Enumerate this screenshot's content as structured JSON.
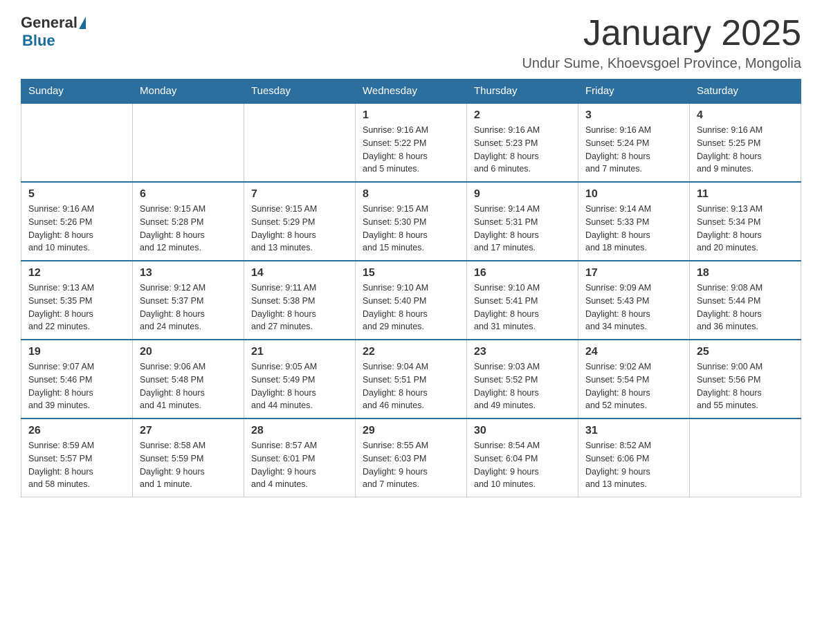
{
  "header": {
    "logo": {
      "general": "General",
      "blue": "Blue"
    },
    "title": "January 2025",
    "location": "Undur Sume, Khoevsgoel Province, Mongolia"
  },
  "calendar": {
    "days_of_week": [
      "Sunday",
      "Monday",
      "Tuesday",
      "Wednesday",
      "Thursday",
      "Friday",
      "Saturday"
    ],
    "weeks": [
      [
        {
          "day": "",
          "info": ""
        },
        {
          "day": "",
          "info": ""
        },
        {
          "day": "",
          "info": ""
        },
        {
          "day": "1",
          "info": "Sunrise: 9:16 AM\nSunset: 5:22 PM\nDaylight: 8 hours\nand 5 minutes."
        },
        {
          "day": "2",
          "info": "Sunrise: 9:16 AM\nSunset: 5:23 PM\nDaylight: 8 hours\nand 6 minutes."
        },
        {
          "day": "3",
          "info": "Sunrise: 9:16 AM\nSunset: 5:24 PM\nDaylight: 8 hours\nand 7 minutes."
        },
        {
          "day": "4",
          "info": "Sunrise: 9:16 AM\nSunset: 5:25 PM\nDaylight: 8 hours\nand 9 minutes."
        }
      ],
      [
        {
          "day": "5",
          "info": "Sunrise: 9:16 AM\nSunset: 5:26 PM\nDaylight: 8 hours\nand 10 minutes."
        },
        {
          "day": "6",
          "info": "Sunrise: 9:15 AM\nSunset: 5:28 PM\nDaylight: 8 hours\nand 12 minutes."
        },
        {
          "day": "7",
          "info": "Sunrise: 9:15 AM\nSunset: 5:29 PM\nDaylight: 8 hours\nand 13 minutes."
        },
        {
          "day": "8",
          "info": "Sunrise: 9:15 AM\nSunset: 5:30 PM\nDaylight: 8 hours\nand 15 minutes."
        },
        {
          "day": "9",
          "info": "Sunrise: 9:14 AM\nSunset: 5:31 PM\nDaylight: 8 hours\nand 17 minutes."
        },
        {
          "day": "10",
          "info": "Sunrise: 9:14 AM\nSunset: 5:33 PM\nDaylight: 8 hours\nand 18 minutes."
        },
        {
          "day": "11",
          "info": "Sunrise: 9:13 AM\nSunset: 5:34 PM\nDaylight: 8 hours\nand 20 minutes."
        }
      ],
      [
        {
          "day": "12",
          "info": "Sunrise: 9:13 AM\nSunset: 5:35 PM\nDaylight: 8 hours\nand 22 minutes."
        },
        {
          "day": "13",
          "info": "Sunrise: 9:12 AM\nSunset: 5:37 PM\nDaylight: 8 hours\nand 24 minutes."
        },
        {
          "day": "14",
          "info": "Sunrise: 9:11 AM\nSunset: 5:38 PM\nDaylight: 8 hours\nand 27 minutes."
        },
        {
          "day": "15",
          "info": "Sunrise: 9:10 AM\nSunset: 5:40 PM\nDaylight: 8 hours\nand 29 minutes."
        },
        {
          "day": "16",
          "info": "Sunrise: 9:10 AM\nSunset: 5:41 PM\nDaylight: 8 hours\nand 31 minutes."
        },
        {
          "day": "17",
          "info": "Sunrise: 9:09 AM\nSunset: 5:43 PM\nDaylight: 8 hours\nand 34 minutes."
        },
        {
          "day": "18",
          "info": "Sunrise: 9:08 AM\nSunset: 5:44 PM\nDaylight: 8 hours\nand 36 minutes."
        }
      ],
      [
        {
          "day": "19",
          "info": "Sunrise: 9:07 AM\nSunset: 5:46 PM\nDaylight: 8 hours\nand 39 minutes."
        },
        {
          "day": "20",
          "info": "Sunrise: 9:06 AM\nSunset: 5:48 PM\nDaylight: 8 hours\nand 41 minutes."
        },
        {
          "day": "21",
          "info": "Sunrise: 9:05 AM\nSunset: 5:49 PM\nDaylight: 8 hours\nand 44 minutes."
        },
        {
          "day": "22",
          "info": "Sunrise: 9:04 AM\nSunset: 5:51 PM\nDaylight: 8 hours\nand 46 minutes."
        },
        {
          "day": "23",
          "info": "Sunrise: 9:03 AM\nSunset: 5:52 PM\nDaylight: 8 hours\nand 49 minutes."
        },
        {
          "day": "24",
          "info": "Sunrise: 9:02 AM\nSunset: 5:54 PM\nDaylight: 8 hours\nand 52 minutes."
        },
        {
          "day": "25",
          "info": "Sunrise: 9:00 AM\nSunset: 5:56 PM\nDaylight: 8 hours\nand 55 minutes."
        }
      ],
      [
        {
          "day": "26",
          "info": "Sunrise: 8:59 AM\nSunset: 5:57 PM\nDaylight: 8 hours\nand 58 minutes."
        },
        {
          "day": "27",
          "info": "Sunrise: 8:58 AM\nSunset: 5:59 PM\nDaylight: 9 hours\nand 1 minute."
        },
        {
          "day": "28",
          "info": "Sunrise: 8:57 AM\nSunset: 6:01 PM\nDaylight: 9 hours\nand 4 minutes."
        },
        {
          "day": "29",
          "info": "Sunrise: 8:55 AM\nSunset: 6:03 PM\nDaylight: 9 hours\nand 7 minutes."
        },
        {
          "day": "30",
          "info": "Sunrise: 8:54 AM\nSunset: 6:04 PM\nDaylight: 9 hours\nand 10 minutes."
        },
        {
          "day": "31",
          "info": "Sunrise: 8:52 AM\nSunset: 6:06 PM\nDaylight: 9 hours\nand 13 minutes."
        },
        {
          "day": "",
          "info": ""
        }
      ]
    ]
  }
}
